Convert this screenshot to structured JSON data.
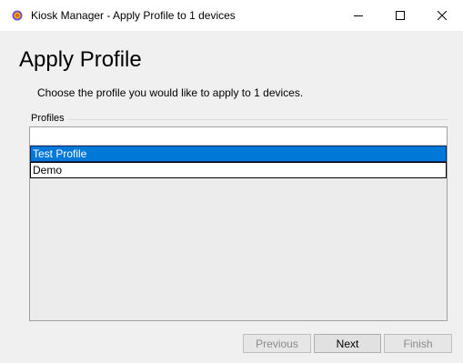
{
  "window": {
    "title": "Kiosk Manager - Apply Profile to 1 devices",
    "app_icon": "kiosk-manager-icon",
    "controls": {
      "minimize_icon": "minimize-icon",
      "maximize_icon": "maximize-icon",
      "close_icon": "close-icon"
    }
  },
  "header": {
    "title": "Apply Profile",
    "instructions": "Choose the profile you would like to apply to 1 devices."
  },
  "profiles": {
    "label": "Profiles",
    "items": [
      {
        "label": "Test Profile",
        "selected": true
      },
      {
        "label": "Demo",
        "selected": false
      }
    ]
  },
  "footer": {
    "previous_label": "Previous",
    "next_label": "Next",
    "finish_label": "Finish",
    "previous_enabled": false,
    "next_enabled": true,
    "finish_enabled": false
  },
  "colors": {
    "selection": "#0078d7",
    "window_bg": "#f0f0f0",
    "titlebar_bg": "#ffffff"
  }
}
